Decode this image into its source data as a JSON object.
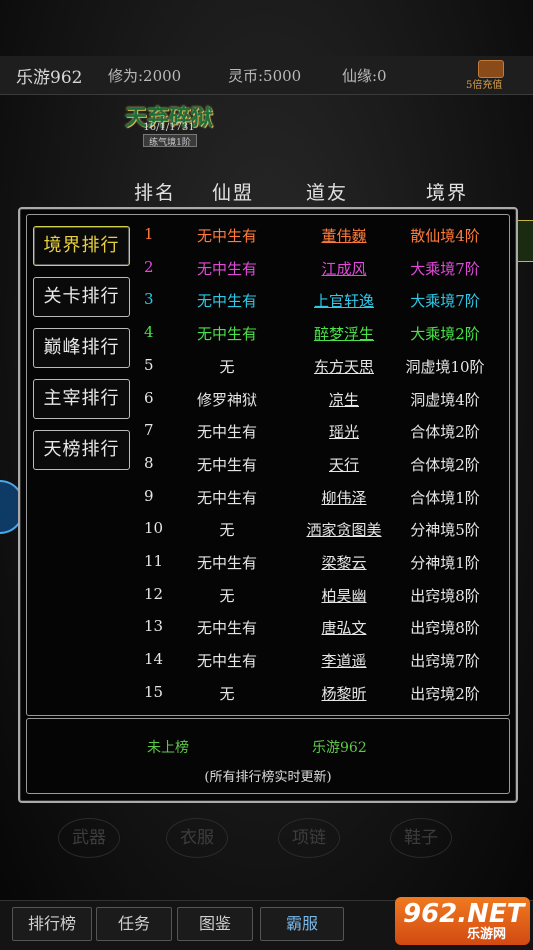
{
  "topbar": {
    "player_name": "乐游962",
    "cultivation": "修为:2000",
    "spirit_coins": "灵币:5000",
    "fate": "仙缘:0",
    "recharge": "5倍充值"
  },
  "badge": {
    "title": "天弃碎狱",
    "stats": "16/1/1731",
    "rank": "练气境1阶"
  },
  "headers": {
    "rank": "排名",
    "guild": "仙盟",
    "friend": "道友",
    "realm": "境界"
  },
  "tabs": [
    {
      "label": "境界排行",
      "active": true
    },
    {
      "label": "关卡排行",
      "active": false
    },
    {
      "label": "巅峰排行",
      "active": false
    },
    {
      "label": "主宰排行",
      "active": false
    },
    {
      "label": "天榜排行",
      "active": false
    }
  ],
  "colors": {
    "rank1": "#ff7a3a",
    "rank2": "#e04ad8",
    "rank3": "#2ec8e8",
    "rank4": "#4ae04a",
    "default": "#e6e6e6"
  },
  "rows": [
    {
      "rank": "1",
      "guild": "无中生有",
      "friend": "董伟巍",
      "realm": "散仙境4阶",
      "color": "#ff7a3a"
    },
    {
      "rank": "2",
      "guild": "无中生有",
      "friend": "江成风",
      "realm": "大乘境7阶",
      "color": "#e04ad8"
    },
    {
      "rank": "3",
      "guild": "无中生有",
      "friend": "上官轩逸",
      "realm": "大乘境7阶",
      "color": "#2ec8e8"
    },
    {
      "rank": "4",
      "guild": "无中生有",
      "friend": "醉梦浮生",
      "realm": "大乘境2阶",
      "color": "#4ae04a"
    },
    {
      "rank": "5",
      "guild": "无",
      "friend": "东方天思",
      "realm": "洞虚境10阶",
      "color": "#e6e6e6"
    },
    {
      "rank": "6",
      "guild": "修罗神狱",
      "friend": "凉生",
      "realm": "洞虚境4阶",
      "color": "#e6e6e6"
    },
    {
      "rank": "7",
      "guild": "无中生有",
      "friend": "瑶光",
      "realm": "合体境2阶",
      "color": "#e6e6e6"
    },
    {
      "rank": "8",
      "guild": "无中生有",
      "friend": "天行",
      "realm": "合体境2阶",
      "color": "#e6e6e6"
    },
    {
      "rank": "9",
      "guild": "无中生有",
      "friend": "柳伟泽",
      "realm": "合体境1阶",
      "color": "#e6e6e6"
    },
    {
      "rank": "10",
      "guild": "无",
      "friend": "洒家贪图美",
      "realm": "分神境5阶",
      "color": "#e6e6e6"
    },
    {
      "rank": "11",
      "guild": "无中生有",
      "friend": "梁黎云",
      "realm": "分神境1阶",
      "color": "#e6e6e6"
    },
    {
      "rank": "12",
      "guild": "无",
      "friend": "柏昊幽",
      "realm": "出窍境8阶",
      "color": "#e6e6e6"
    },
    {
      "rank": "13",
      "guild": "无中生有",
      "friend": "唐弘文",
      "realm": "出窍境8阶",
      "color": "#e6e6e6"
    },
    {
      "rank": "14",
      "guild": "无中生有",
      "friend": "李道遥",
      "realm": "出窍境7阶",
      "color": "#e6e6e6"
    },
    {
      "rank": "15",
      "guild": "无",
      "friend": "杨黎昕",
      "realm": "出窍境2阶",
      "color": "#e6e6e6"
    }
  ],
  "footer": {
    "status": "未上榜",
    "player": "乐游962",
    "note": "(所有排行榜实时更新)"
  },
  "equipment": [
    "武器",
    "衣服",
    "项链",
    "鞋子"
  ],
  "nav": [
    "排行榜",
    "任务",
    "图鉴",
    "霸服"
  ],
  "watermark": {
    "brand": "962.NET",
    "name": "乐游网"
  }
}
